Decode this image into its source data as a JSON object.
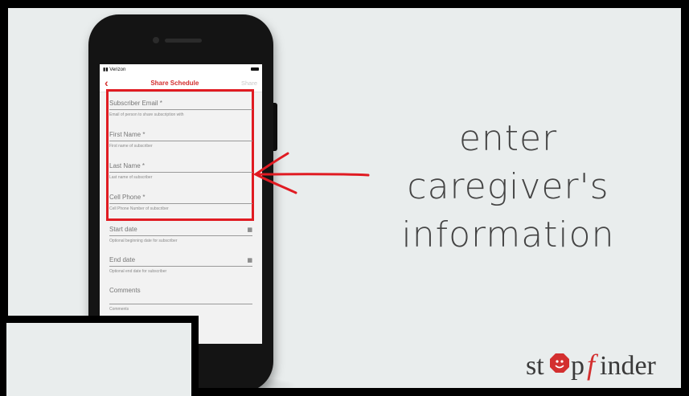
{
  "phone": {
    "status": {
      "carrier": "Verizon"
    },
    "nav": {
      "back_icon": "chevron-left-icon",
      "title": "Share Schedule",
      "share_label": "Share"
    },
    "form": {
      "fields": [
        {
          "label": "Subscriber Email *",
          "hint": "Email of person to share subscription with"
        },
        {
          "label": "First Name *",
          "hint": "First name of subscriber"
        },
        {
          "label": "Last Name *",
          "hint": "Last name of subscriber"
        },
        {
          "label": "Cell Phone *",
          "hint": "Cell Phone Number of subscriber"
        },
        {
          "label": "Start date",
          "hint": "Optional beginning date for subscriber",
          "icon": "calendar-icon"
        },
        {
          "label": "End date",
          "hint": "Optional end date for subscriber",
          "icon": "calendar-icon"
        },
        {
          "label": "Comments",
          "hint": "Comments"
        }
      ]
    }
  },
  "annotation": {
    "caption_lines": [
      "enter",
      "caregiver's",
      "information"
    ],
    "arrow_color": "#e01b22"
  },
  "logo": {
    "part1": "st",
    "part2": "p",
    "part3": "finder",
    "brand_color": "#d32f2f"
  },
  "colors": {
    "accent": "#d32f2f",
    "background": "#e9eded"
  }
}
